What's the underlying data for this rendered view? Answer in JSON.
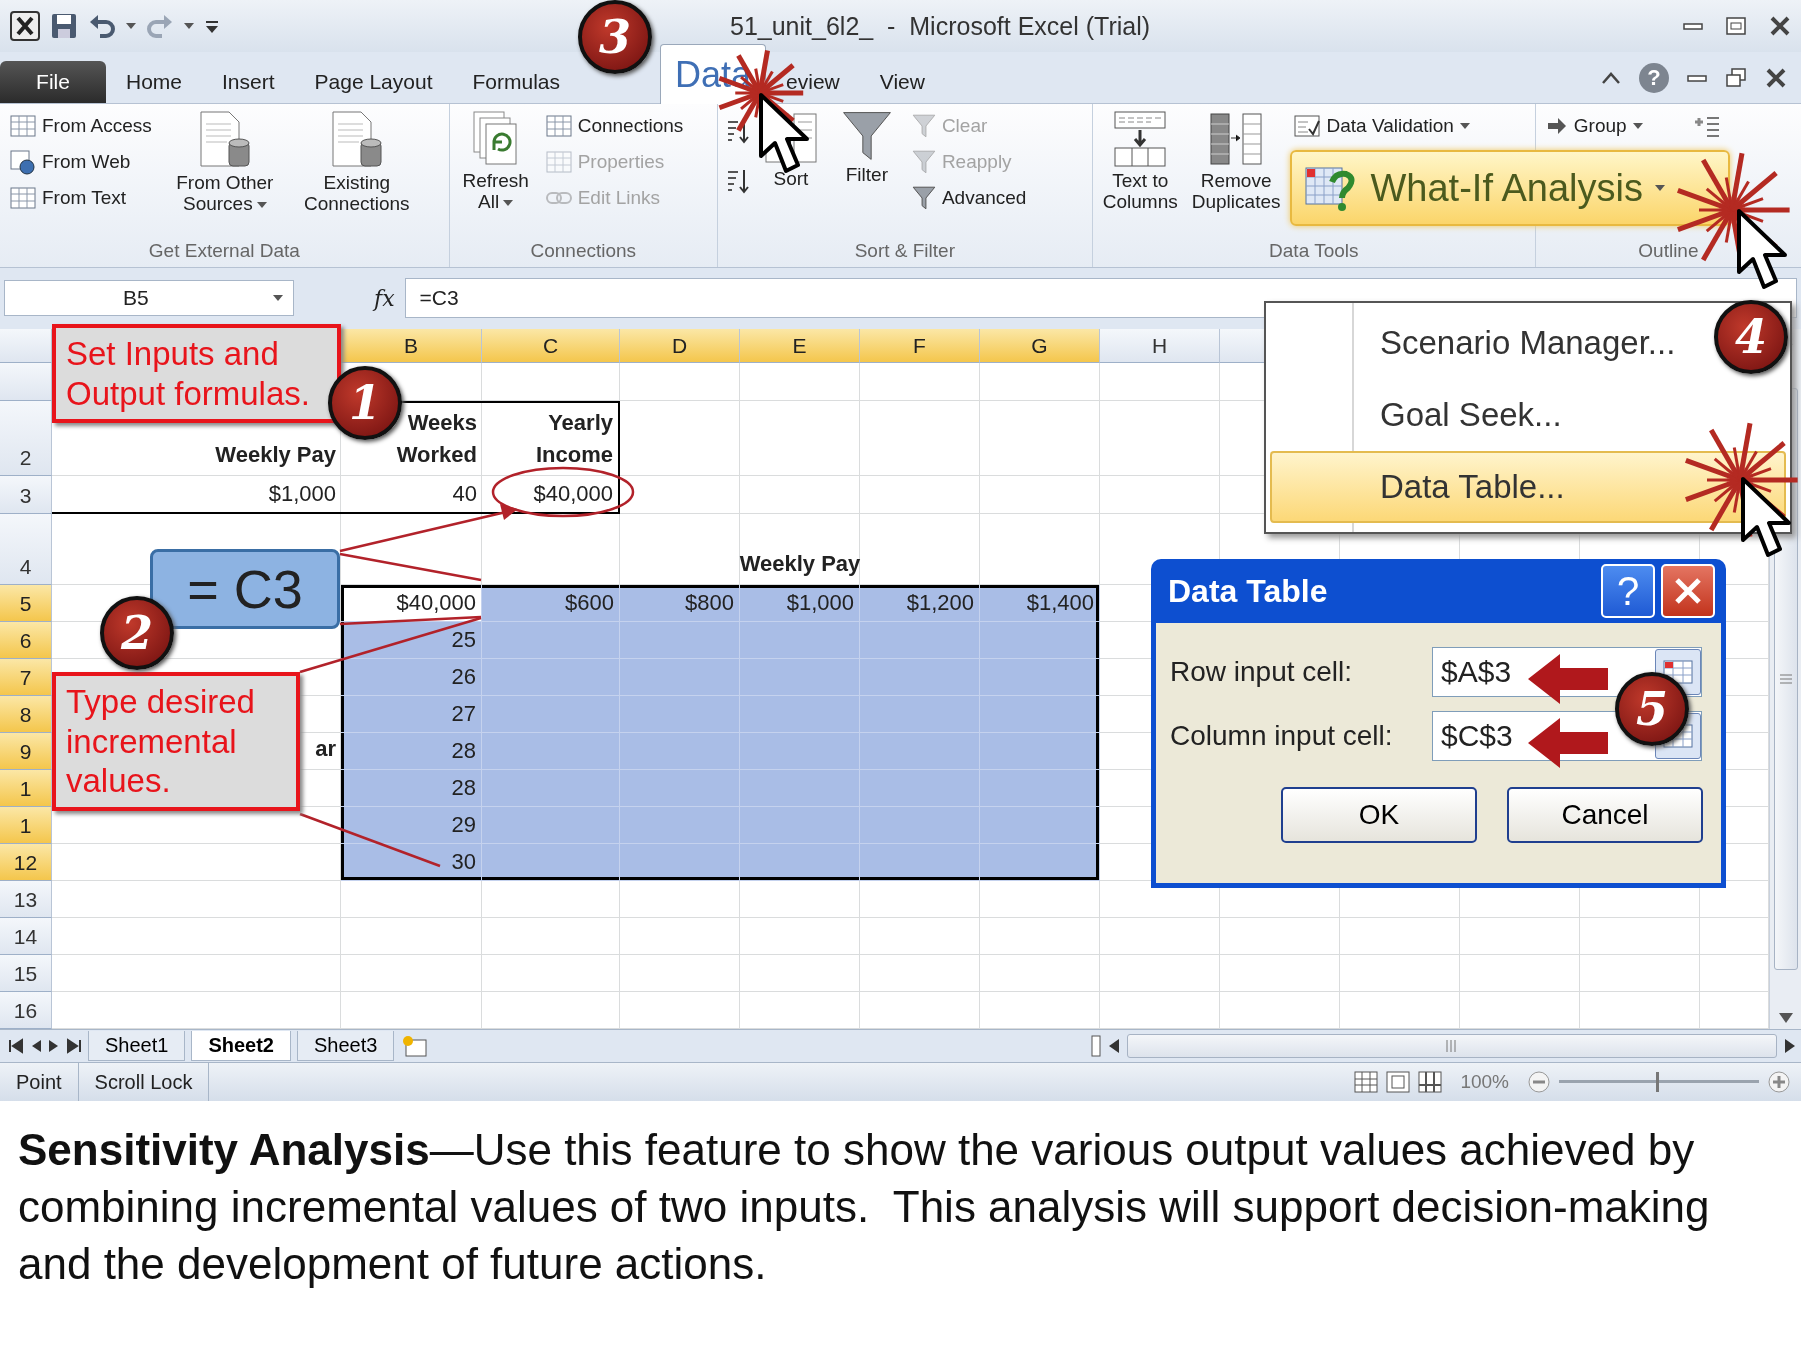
{
  "window": {
    "title": "51_unit_6l2_  -  Microsoft Excel (Trial)"
  },
  "ribbon_tabs": [
    {
      "label": "File",
      "kind": "file",
      "selected": false
    },
    {
      "label": "Home",
      "kind": "tab",
      "selected": false
    },
    {
      "label": "Insert",
      "kind": "tab",
      "selected": false
    },
    {
      "label": "Page Layout",
      "kind": "tab",
      "selected": false
    },
    {
      "label": "Formulas",
      "kind": "tab",
      "selected": false
    },
    {
      "label": "Data",
      "kind": "tab",
      "selected": true
    },
    {
      "label": "eview",
      "kind": "tab",
      "selected": false
    },
    {
      "label": "View",
      "kind": "tab",
      "selected": false
    }
  ],
  "help_button": "?",
  "ribbon_groups": [
    {
      "label": "Get External Data",
      "buttons": [
        {
          "label": "From Access",
          "disabled": false,
          "dropdown": false
        },
        {
          "label": "From Web",
          "disabled": false,
          "dropdown": false
        },
        {
          "label": "From Text",
          "disabled": false,
          "dropdown": false
        },
        {
          "label": "From Other Sources",
          "disabled": false,
          "dropdown": true
        },
        {
          "label": "Existing Connections",
          "disabled": false,
          "dropdown": false
        }
      ]
    },
    {
      "label": "Connections",
      "buttons": [
        {
          "label": "Refresh All",
          "disabled": false,
          "dropdown": true
        },
        {
          "label": "Connections",
          "disabled": false,
          "dropdown": false
        },
        {
          "label": "Properties",
          "disabled": true,
          "dropdown": false
        },
        {
          "label": "Edit Links",
          "disabled": true,
          "dropdown": false
        }
      ]
    },
    {
      "label": "Sort & Filter",
      "buttons": [
        {
          "label": "Sort",
          "disabled": false,
          "dropdown": false
        },
        {
          "label": "Filter",
          "disabled": false,
          "dropdown": false
        },
        {
          "label": "Clear",
          "disabled": true,
          "dropdown": false
        },
        {
          "label": "Reapply",
          "disabled": true,
          "dropdown": false
        },
        {
          "label": "Advanced",
          "disabled": false,
          "dropdown": false
        }
      ]
    },
    {
      "label": "Data Tools",
      "buttons": [
        {
          "label": "Text to Columns",
          "disabled": false,
          "dropdown": false
        },
        {
          "label": "Remove Duplicates",
          "disabled": false,
          "dropdown": false
        },
        {
          "label": "Data Validation",
          "disabled": false,
          "dropdown": true
        },
        {
          "label": "What-If Analysis",
          "disabled": false,
          "dropdown": true,
          "highlighted": true
        }
      ]
    },
    {
      "label": "Outline",
      "buttons": [
        {
          "label": "Group",
          "disabled": false,
          "dropdown": true
        }
      ]
    }
  ],
  "formula_bar": {
    "name_box": "B5",
    "function_label": "fx",
    "formula": "=C3"
  },
  "sheet": {
    "columns": [
      {
        "label": "B",
        "selected": true
      },
      {
        "label": "C",
        "selected": true
      },
      {
        "label": "D",
        "selected": true
      },
      {
        "label": "E",
        "selected": true
      },
      {
        "label": "F",
        "selected": true
      },
      {
        "label": "G",
        "selected": true
      },
      {
        "label": "H",
        "selected": false
      }
    ],
    "rows": [
      {
        "selected": false
      },
      {
        "label": "2",
        "selected": false
      },
      {
        "label": "3",
        "selected": false
      },
      {
        "label": "4",
        "selected": false
      },
      {
        "label": "5",
        "selected": true
      },
      {
        "label": "6",
        "selected": true
      },
      {
        "label": "7",
        "selected": true
      },
      {
        "label": "8",
        "selected": true
      },
      {
        "label": "9",
        "selected": true
      },
      {
        "label": "1",
        "selected": true
      },
      {
        "label": "1",
        "selected": true
      },
      {
        "label": "12",
        "selected": true
      },
      {
        "label": "13",
        "selected": false
      },
      {
        "label": "14",
        "selected": false
      },
      {
        "label": "15",
        "selected": false
      },
      {
        "label": "16",
        "selected": false
      }
    ],
    "input_table": {
      "headers": [
        "Weekly Pay",
        "Weeks Worked",
        "Yearly Income"
      ],
      "values": [
        "$1,000",
        "40",
        "$40,000"
      ]
    },
    "data_table": {
      "title": "Weekly Pay",
      "formula_cell": "$40,000",
      "row_inputs": [
        "$600",
        "$800",
        "$1,000",
        "$1,200",
        "$1,400"
      ],
      "column_inputs": [
        "25",
        "26",
        "27",
        "28",
        "28",
        "29",
        "30"
      ]
    },
    "covered_text": "ar"
  },
  "sheet_tabs": [
    {
      "label": "Sheet1",
      "selected": false
    },
    {
      "label": "Sheet2",
      "selected": true
    },
    {
      "label": "Sheet3",
      "selected": false
    }
  ],
  "status_bar": {
    "items": [
      "Point",
      "Scroll Lock"
    ],
    "zoom": "100%",
    "zoom_slider": {
      "level": 0.5
    }
  },
  "what_if_menu": {
    "items": [
      {
        "label": "Scenario Manager...",
        "selected": false
      },
      {
        "label": "Goal Seek...",
        "selected": false
      },
      {
        "label": "Data Table...",
        "selected": true
      }
    ]
  },
  "dialog": {
    "title": "Data Table",
    "help": "?",
    "fields": [
      {
        "label": "Row input cell:",
        "value": "$A$3"
      },
      {
        "label": "Column input cell:",
        "value": "$C$3"
      }
    ],
    "buttons": [
      "OK",
      "Cancel"
    ]
  },
  "callouts": [
    "Set Inputs and Output formulas.",
    "Type desired incremental values."
  ],
  "formula_note": "= C3",
  "step_numbers": [
    "1",
    "2",
    "3",
    "4",
    "5"
  ],
  "caption": "**Sensitivity Analysis**—Use this feature to show the various output values achieved by combining incremental values of two inputs.  This analysis will support decision-making and the development of future actions."
}
